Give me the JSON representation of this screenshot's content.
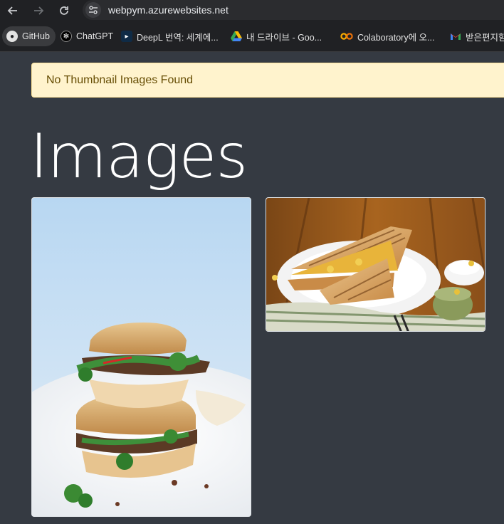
{
  "browser": {
    "url": "webpym.azurewebsites.net",
    "bookmarks": [
      {
        "label": "GitHub",
        "icon": "github-icon"
      },
      {
        "label": "ChatGPT",
        "icon": "chatgpt-icon"
      },
      {
        "label": "DeepL 번역: 세계에...",
        "icon": "deepl-icon"
      },
      {
        "label": "내 드라이브 - Goo...",
        "icon": "google-drive-icon"
      },
      {
        "label": "Colaboratory에 오...",
        "icon": "colab-icon"
      },
      {
        "label": "받은편지함",
        "icon": "gmail-icon"
      }
    ]
  },
  "page": {
    "alert_text": "No Thumbnail Images Found",
    "heading": "Images",
    "images": [
      {
        "name": "banh-mi-sandwich-photo"
      },
      {
        "name": "grilled-sandwich-photo"
      }
    ]
  },
  "colors": {
    "background": "#353a42",
    "alert_bg": "#fff3cd",
    "alert_text": "#664d03"
  }
}
